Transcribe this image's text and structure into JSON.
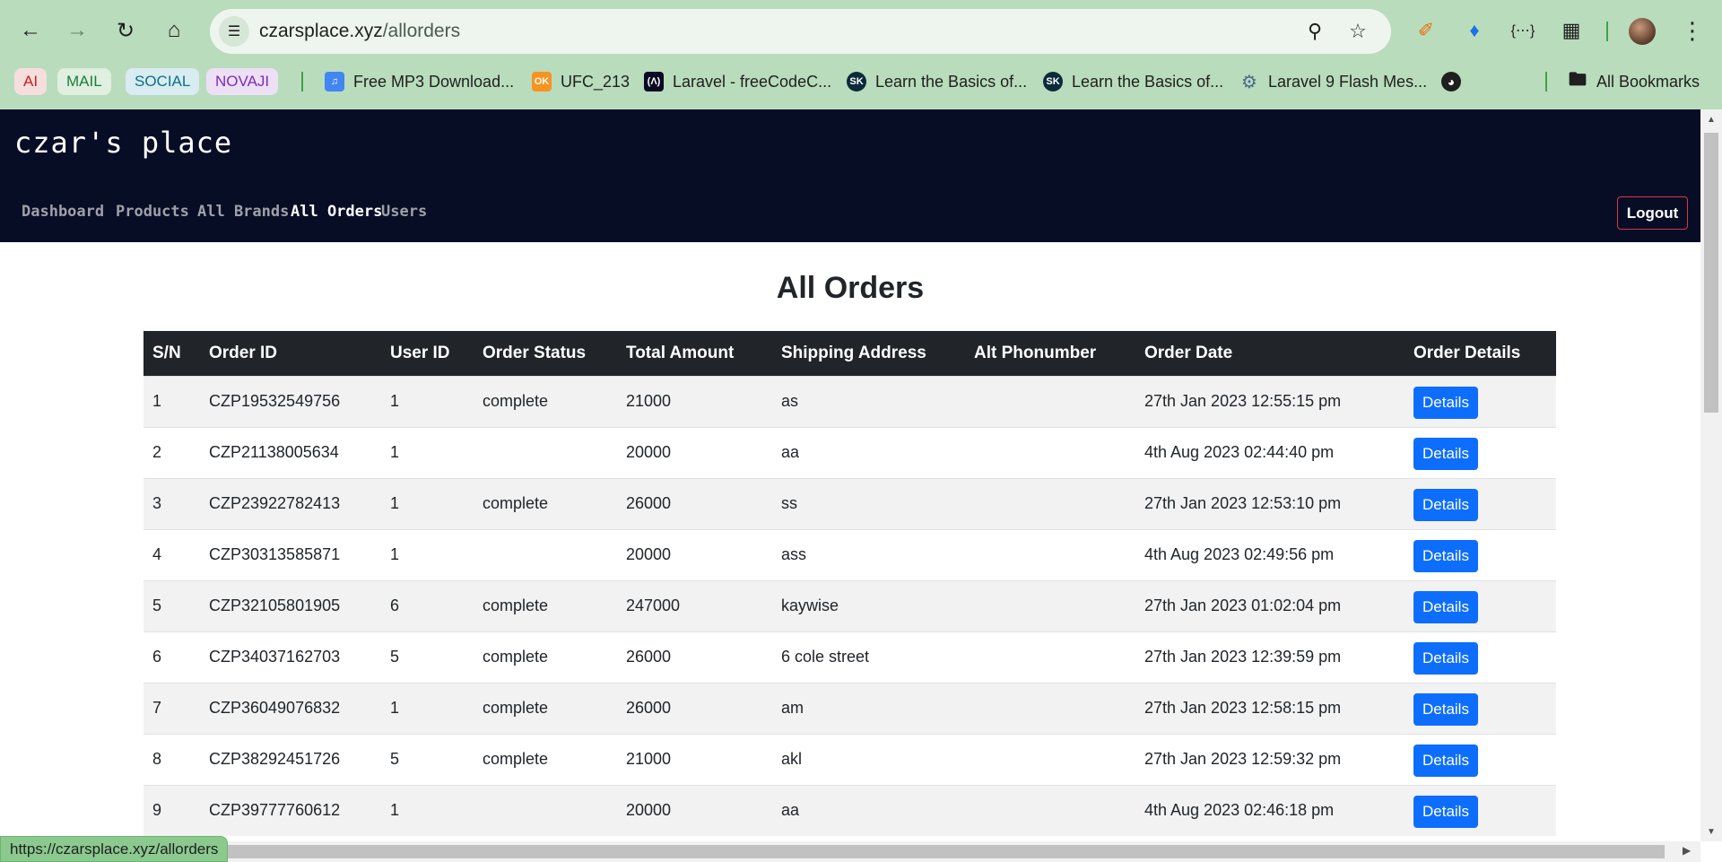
{
  "browser": {
    "url_domain": "czarsplace.xyz",
    "url_path": "/allorders",
    "bookmark_chips": [
      {
        "label": "AI",
        "bg": "#f7dede",
        "fg": "#c5221f"
      },
      {
        "label": "MAIL",
        "bg": "#e0efe0",
        "fg": "#188038"
      },
      {
        "label": "SOCIAL",
        "bg": "#d8ecf2",
        "fg": "#0b7285"
      },
      {
        "label": "NOVAJI",
        "bg": "#ede0f5",
        "fg": "#7b2cbf"
      }
    ],
    "bookmarks": [
      {
        "label": "Free MP3 Download...",
        "icon": "music-note-icon",
        "color": "#4285f4"
      },
      {
        "label": "UFC_213",
        "icon": "odnoklassniki-icon",
        "color": "#f7931e"
      },
      {
        "label": "Laravel - freeCodeC...",
        "icon": "freecodecamp-icon",
        "color": "#0a0a23"
      },
      {
        "label": "Learn the Basics of...",
        "icon": "sk-icon",
        "color": "#0b2b3a"
      },
      {
        "label": "Learn the Basics of...",
        "icon": "sk-icon",
        "color": "#0b2b3a"
      },
      {
        "label": "Laravel 9 Flash Mes...",
        "icon": "gear-icon",
        "color": "#4b6b8a"
      }
    ],
    "all_bookmarks": "All Bookmarks",
    "status_url": "https://czarsplace.xyz/allorders"
  },
  "app": {
    "brand": "czar's place",
    "nav": [
      "Dashboard",
      "Products",
      "All Brands",
      "All Orders",
      "Users"
    ],
    "active_nav": "All Orders",
    "logout": "Logout"
  },
  "main": {
    "title": "All Orders",
    "columns": [
      "S/N",
      "Order ID",
      "User ID",
      "Order Status",
      "Total Amount",
      "Shipping Address",
      "Alt Phonumber",
      "Order Date",
      "Order Details"
    ],
    "details_label": "Details",
    "rows": [
      {
        "sn": "1",
        "order_id": "CZP19532549756",
        "user_id": "1",
        "status": "complete",
        "amount": "21000",
        "address": "as",
        "alt_phone": "",
        "date": "27th Jan 2023 12:55:15 pm"
      },
      {
        "sn": "2",
        "order_id": "CZP21138005634",
        "user_id": "1",
        "status": "",
        "amount": "20000",
        "address": "aa",
        "alt_phone": "",
        "date": "4th Aug 2023 02:44:40 pm"
      },
      {
        "sn": "3",
        "order_id": "CZP23922782413",
        "user_id": "1",
        "status": "complete",
        "amount": "26000",
        "address": "ss",
        "alt_phone": "",
        "date": "27th Jan 2023 12:53:10 pm"
      },
      {
        "sn": "4",
        "order_id": "CZP30313585871",
        "user_id": "1",
        "status": "",
        "amount": "20000",
        "address": "ass",
        "alt_phone": "",
        "date": "4th Aug 2023 02:49:56 pm"
      },
      {
        "sn": "5",
        "order_id": "CZP32105801905",
        "user_id": "6",
        "status": "complete",
        "amount": "247000",
        "address": "kaywise",
        "alt_phone": "",
        "date": "27th Jan 2023 01:02:04 pm"
      },
      {
        "sn": "6",
        "order_id": "CZP34037162703",
        "user_id": "5",
        "status": "complete",
        "amount": "26000",
        "address": "6 cole street",
        "alt_phone": "",
        "date": "27th Jan 2023 12:39:59 pm"
      },
      {
        "sn": "7",
        "order_id": "CZP36049076832",
        "user_id": "1",
        "status": "complete",
        "amount": "26000",
        "address": "am",
        "alt_phone": "",
        "date": "27th Jan 2023 12:58:15 pm"
      },
      {
        "sn": "8",
        "order_id": "CZP38292451726",
        "user_id": "5",
        "status": "complete",
        "amount": "21000",
        "address": "akl",
        "alt_phone": "",
        "date": "27th Jan 2023 12:59:32 pm"
      },
      {
        "sn": "9",
        "order_id": "CZP39777760612",
        "user_id": "1",
        "status": "",
        "amount": "20000",
        "address": "aa",
        "alt_phone": "",
        "date": "4th Aug 2023 02:46:18 pm"
      }
    ]
  }
}
